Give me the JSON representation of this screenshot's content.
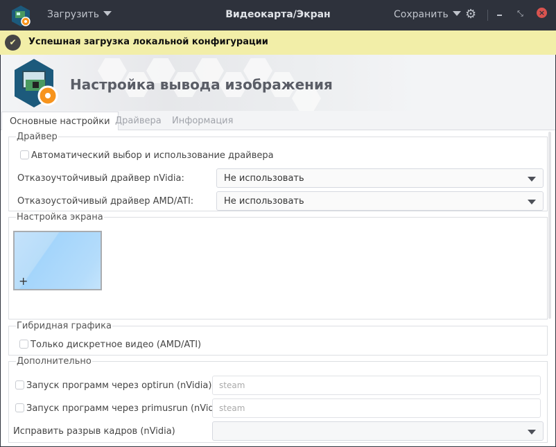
{
  "titlebar": {
    "load_label": "Загрузить",
    "title": "Видеокарта/Экран",
    "save_label": "Сохранить",
    "settings_icon": "gear-icon",
    "minimize_icon": "minimize-icon",
    "maximize_icon": "maximize-icon",
    "close_icon": "close-icon",
    "close_color": "#d9534f"
  },
  "notice": {
    "text": "Успешная загрузка локальной конфигурации",
    "icon": "check-circle-icon",
    "background": "#f2eea8"
  },
  "header": {
    "title": "Настройка вывода изображения"
  },
  "tabs": [
    {
      "label": "Основные настройки",
      "active": true
    },
    {
      "label": "Драйвера"
    },
    {
      "label": "Информация"
    }
  ],
  "driver": {
    "legend": "Драйвер",
    "auto_label": "Автоматический выбор и использование драйвера",
    "auto_checked": false,
    "nvidia_label": "Отказоучтойчивый драйвер nVidia:",
    "nvidia_value": "Не использовать",
    "amd_label": "Отказоустойчивый драйвер AMD/ATI:",
    "amd_value": "Не использовать"
  },
  "screen": {
    "legend": "Настройка экрана",
    "add_symbol": "+"
  },
  "hybrid": {
    "legend": "Гибридная графика",
    "discrete_label": "Только дискретное видео (AMD/ATI)",
    "discrete_checked": false
  },
  "extra": {
    "legend": "Дополнительно",
    "optirun_label": "Запуск программ через optirun (nVidia)",
    "optirun_placeholder": "steam",
    "primusrun_label": "Запуск программ через primusrun (nVidia)",
    "primusrun_placeholder": "steam",
    "tearing_label": "Исправить разрыв кадров (nVidia)",
    "tearing_value": ""
  }
}
